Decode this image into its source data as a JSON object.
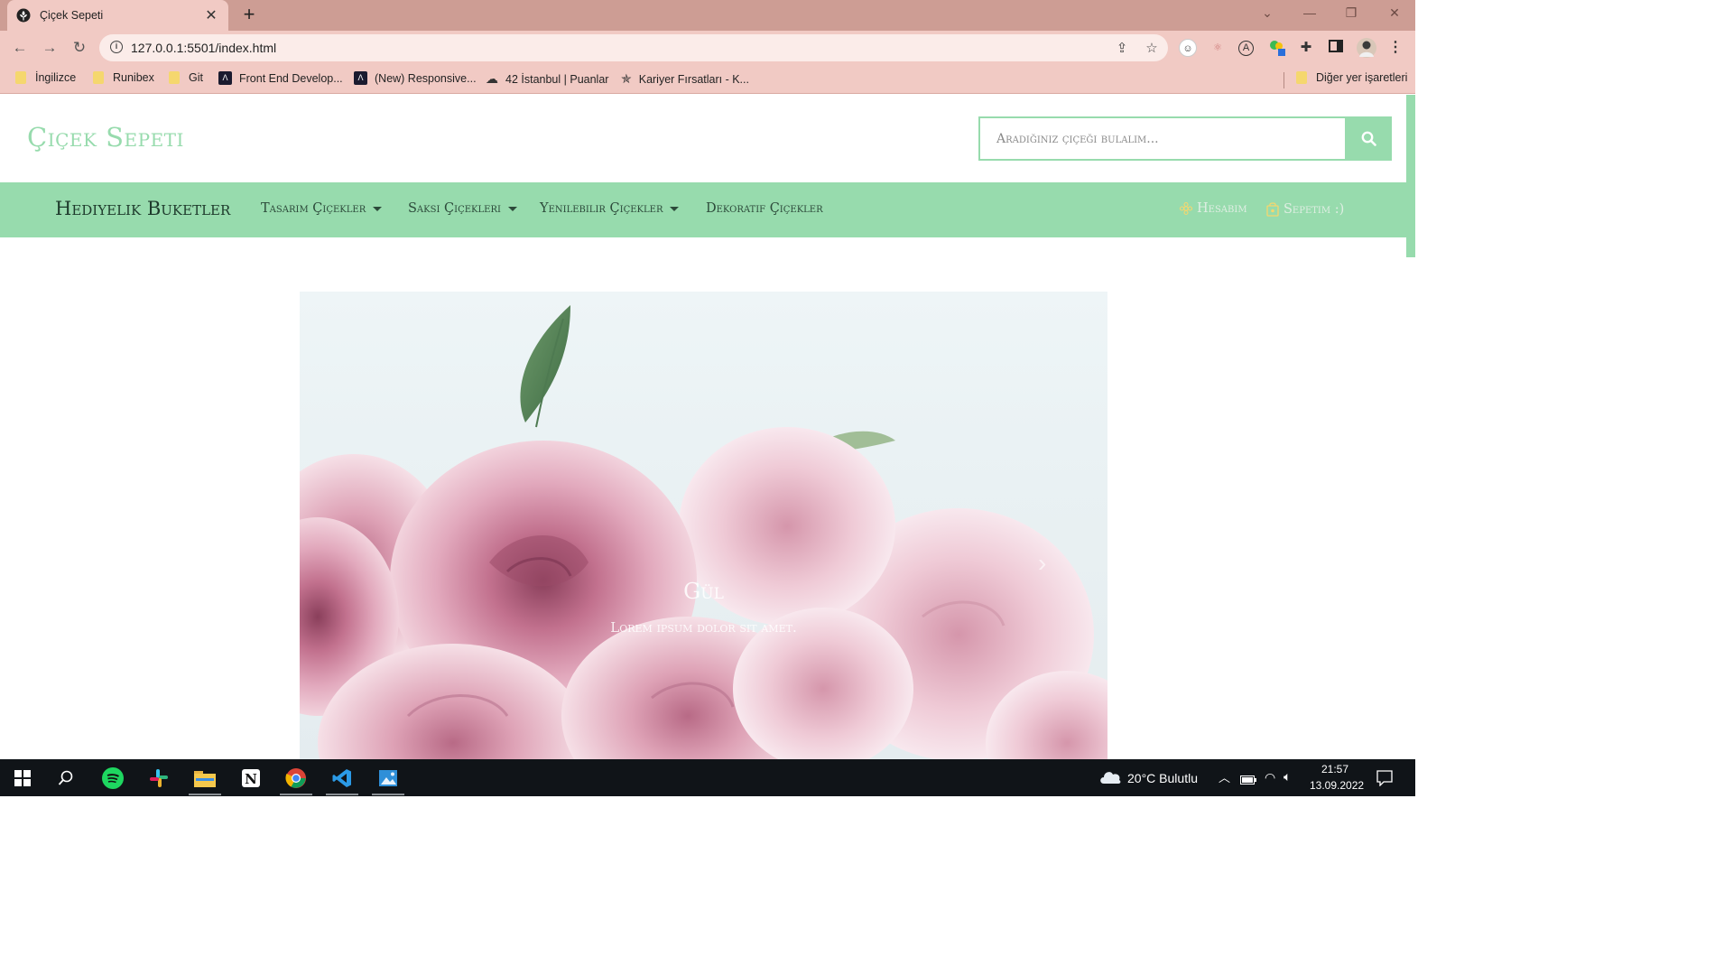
{
  "browser": {
    "tab": {
      "title": "Çiçek Sepeti",
      "favicon": "flower-icon"
    },
    "url": "127.0.0.1:5501/index.html",
    "bookmarks": [
      {
        "label": "İngilizce",
        "icon": "folder-icon"
      },
      {
        "label": "Runibex",
        "icon": "folder-icon"
      },
      {
        "label": "Git",
        "icon": "folder-icon"
      },
      {
        "label": "Front End Develop...",
        "icon": "site-icon"
      },
      {
        "label": "(New) Responsive...",
        "icon": "site-icon"
      },
      {
        "label": "42 İstanbul | Puanlar",
        "icon": "site-icon"
      },
      {
        "label": "Kariyer Fırsatları - K...",
        "icon": "site-icon"
      }
    ],
    "other_bookmarks": "Diğer yer işaretleri"
  },
  "site": {
    "brand": "Çiçek Sepeti",
    "search": {
      "placeholder": "Aradığınız çiçeği bulalım..."
    },
    "nav": {
      "brand": "Hediyelik Buketler",
      "links": [
        {
          "label": "Tasarım Çiçekler",
          "dropdown": true
        },
        {
          "label": "Saksı Çiçekleri",
          "dropdown": true
        },
        {
          "label": "Yenilebilir Çiçekler",
          "dropdown": true
        },
        {
          "label": "Dekoratif Çiçekler",
          "dropdown": false
        }
      ],
      "account": "Hesabım",
      "cart": "Sepetim :)"
    },
    "carousel": {
      "title": "Gül",
      "text": "Lorem ipsum dolor sit amet."
    }
  },
  "taskbar": {
    "weather": "20°C  Bulutlu",
    "time": "21:57",
    "date": "13.09.2022"
  },
  "colors": {
    "accent": "#97dbad",
    "browser_frame": "#cd9d94",
    "browser_toolbar": "#f1cac4",
    "taskbar": "#101418"
  }
}
